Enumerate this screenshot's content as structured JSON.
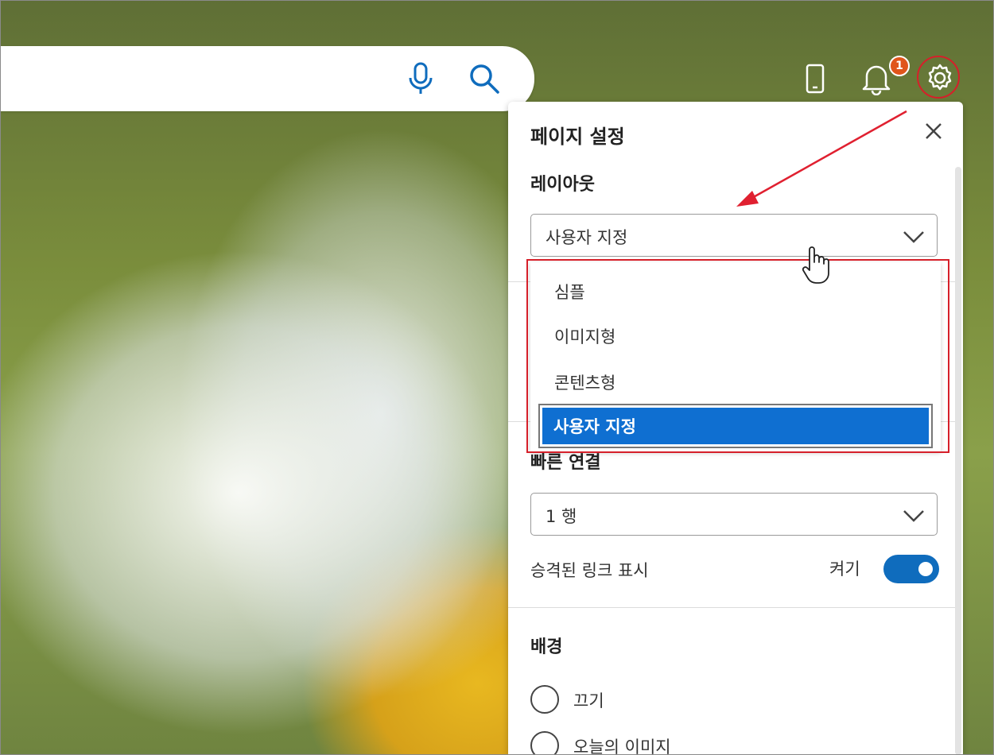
{
  "search": {
    "mic_icon": "mic-icon",
    "search_icon": "search-icon"
  },
  "header": {
    "phone_icon": "phone-icon",
    "bell_icon": "bell-icon",
    "notification_count": "1",
    "gear_icon": "gear-icon"
  },
  "panel": {
    "title": "페이지 설정",
    "close_icon": "close-icon",
    "layout": {
      "label": "레이아웃",
      "selected": "사용자 지정",
      "options": [
        "심플",
        "이미지형",
        "콘텐츠형",
        "사용자 지정"
      ]
    },
    "quick_links": {
      "label": "빠른 연결",
      "rows_selected": "1 행",
      "promoted_label": "승격된 링크 표시",
      "toggle_label": "켜기",
      "toggle_on": true
    },
    "background": {
      "label": "배경",
      "options": [
        "끄기",
        "오늘의 이미지"
      ]
    }
  },
  "colors": {
    "accent": "#0f6cbd",
    "selected_option": "#0f6fd1",
    "annotation": "#d6202a",
    "badge": "#e0551b"
  }
}
